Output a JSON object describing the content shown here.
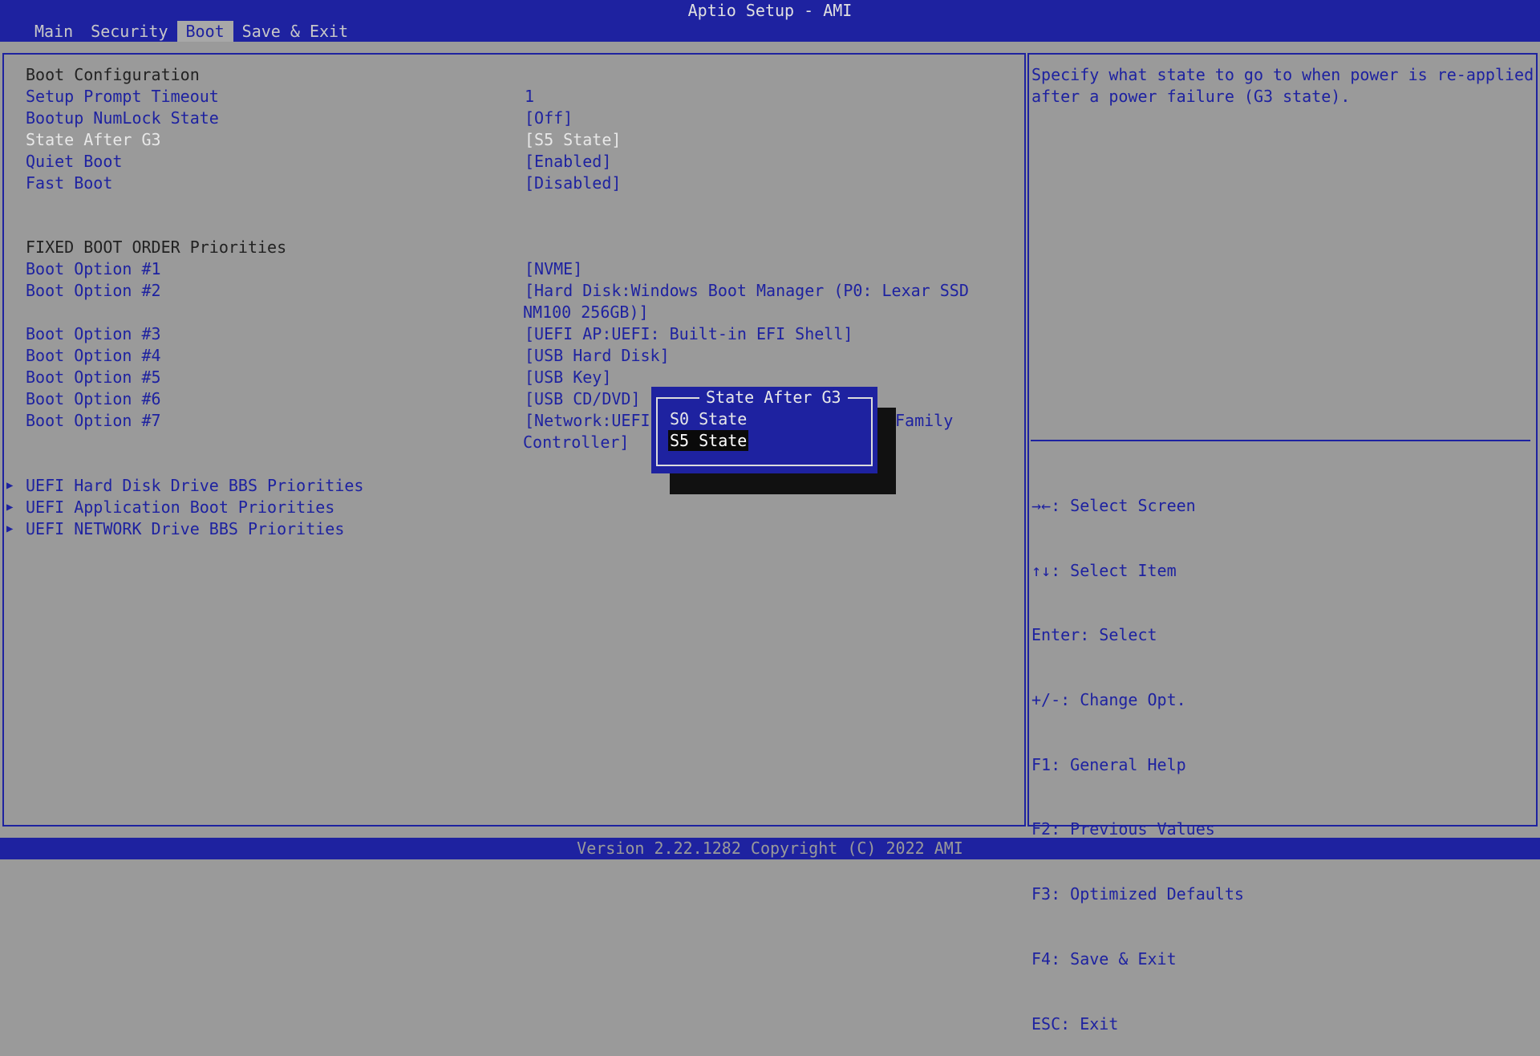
{
  "app": {
    "title": "Aptio Setup - AMI"
  },
  "tabs": [
    {
      "label": "Main"
    },
    {
      "label": "Security"
    },
    {
      "label": "Boot"
    },
    {
      "label": "Save & Exit"
    }
  ],
  "boot": {
    "section_title": "Boot Configuration",
    "items": [
      {
        "label": "Setup Prompt Timeout",
        "value": "1"
      },
      {
        "label": "Bootup NumLock State",
        "value": "[Off]"
      },
      {
        "label": "State After G3",
        "value": "[S5 State]"
      },
      {
        "label": "Quiet Boot",
        "value": "[Enabled]"
      },
      {
        "label": "Fast Boot",
        "value": "[Disabled]"
      }
    ],
    "fixed_order_title": "FIXED BOOT ORDER Priorities",
    "boot_options": [
      {
        "label": "Boot Option #1",
        "value": "[NVME]"
      },
      {
        "label": "Boot Option #2",
        "value": "[Hard Disk:Windows Boot Manager (P0: Lexar SSD",
        "value2": "NM100 256GB)]"
      },
      {
        "label": "Boot Option #3",
        "value": "[UEFI AP:UEFI: Built-in EFI Shell]"
      },
      {
        "label": "Boot Option #4",
        "value": "[USB Hard Disk]"
      },
      {
        "label": "Boot Option #5",
        "value": "[USB Key]"
      },
      {
        "label": "Boot Option #6",
        "value": "[USB CD/DVD]"
      },
      {
        "label": "Boot Option #7",
        "value": "[Network:UEFI:",
        "value_tail": "Family",
        "value2": "Controller]"
      }
    ],
    "submenus": [
      {
        "label": "UEFI Hard Disk Drive BBS Priorities"
      },
      {
        "label": "UEFI Application Boot Priorities"
      },
      {
        "label": "UEFI NETWORK Drive BBS Priorities"
      }
    ]
  },
  "help": {
    "line1": "Specify what state to go to when power is re-applied",
    "line2": "after a power failure (G3 state)."
  },
  "keys": [
    {
      "text": "→←: Select Screen"
    },
    {
      "text": "↑↓: Select Item"
    },
    {
      "text": "Enter: Select"
    },
    {
      "text": "+/-: Change Opt."
    },
    {
      "text": "F1: General Help"
    },
    {
      "text": "F2: Previous Values"
    },
    {
      "text": "F3: Optimized Defaults"
    },
    {
      "text": "F4: Save & Exit"
    },
    {
      "text": "ESC: Exit"
    }
  ],
  "popup": {
    "title": "State After G3",
    "options": [
      {
        "label": "S0 State"
      },
      {
        "label": "S5 State"
      }
    ]
  },
  "footer": {
    "text": "Version 2.22.1282 Copyright (C) 2022 AMI"
  }
}
